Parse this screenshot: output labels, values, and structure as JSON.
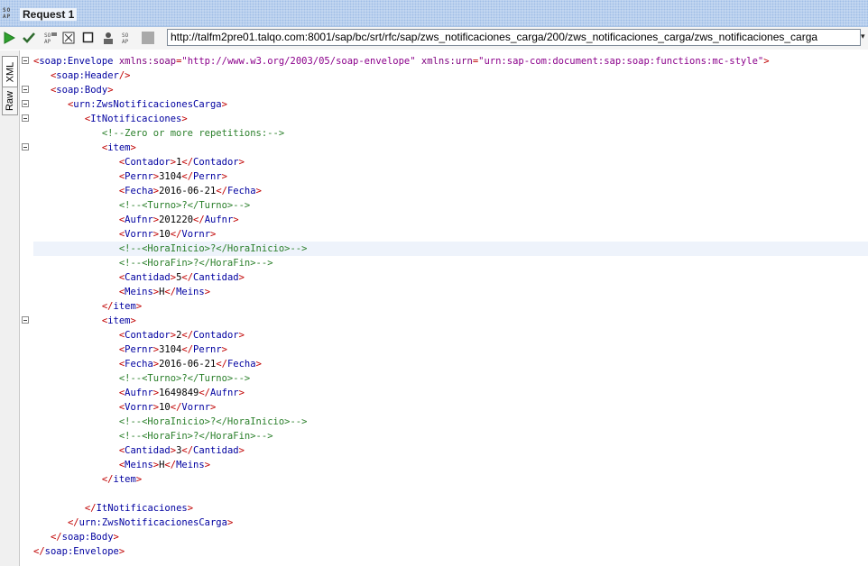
{
  "window": {
    "title": "Request 1",
    "logo_text": "SOAP"
  },
  "toolbar": {
    "endpoint_url": "http://talfm2pre01.talqo.com:8001/sap/bc/srt/rfc/sap/zws_notificaciones_carga/200/zws_notificaciones_carga/zws_notificaciones_carga"
  },
  "side_tabs": {
    "xml": "XML",
    "raw": "Raw"
  },
  "editor": {
    "lines": [
      "<soap:Envelope xmlns:soap=\"http://www.w3.org/2003/05/soap-envelope\" xmlns:urn=\"urn:sap-com:document:sap:soap:functions:mc-style\">",
      "   <soap:Header/>",
      "   <soap:Body>",
      "      <urn:ZwsNotificacionesCarga>",
      "         <ItNotificaciones>",
      "            <!--Zero or more repetitions:-->",
      "            <item>",
      "               <Contador>1</Contador>",
      "               <Pernr>3104</Pernr>",
      "               <Fecha>2016-06-21</Fecha>",
      "               <!--<Turno>?</Turno>-->",
      "               <Aufnr>201220</Aufnr>",
      "               <Vornr>10</Vornr>",
      "               <!--<HoraInicio>?</HoraInicio>-->",
      "               <!--<HoraFin>?</HoraFin>-->",
      "               <Cantidad>5</Cantidad>",
      "               <Meins>H</Meins>",
      "            </item>",
      "            <item>",
      "               <Contador>2</Contador>",
      "               <Pernr>3104</Pernr>",
      "               <Fecha>2016-06-21</Fecha>",
      "               <!--<Turno>?</Turno>-->",
      "               <Aufnr>1649849</Aufnr>",
      "               <Vornr>10</Vornr>",
      "               <!--<HoraInicio>?</HoraInicio>-->",
      "               <!--<HoraFin>?</HoraFin>-->",
      "               <Cantidad>3</Cantidad>",
      "               <Meins>H</Meins>",
      "            </item>",
      "",
      "         </ItNotificaciones>",
      "      </urn:ZwsNotificacionesCarga>",
      "   </soap:Body>",
      "</soap:Envelope>"
    ],
    "folded_lines": [
      0,
      2,
      3,
      4,
      6,
      18
    ],
    "highlighted_line": 13
  },
  "icons": [
    "run-icon",
    "check-icon",
    "wsa-icon",
    "expand-icon",
    "stop-icon",
    "user-icon",
    "wss-icon",
    "grey-box-icon",
    "chevron-down-icon"
  ],
  "colors": {
    "tag": "#7f0055",
    "bracket": "#c00000",
    "name": "#0000a0",
    "attr": "#7f007f",
    "value": "#8b008b",
    "comment": "#2a7f2a"
  }
}
